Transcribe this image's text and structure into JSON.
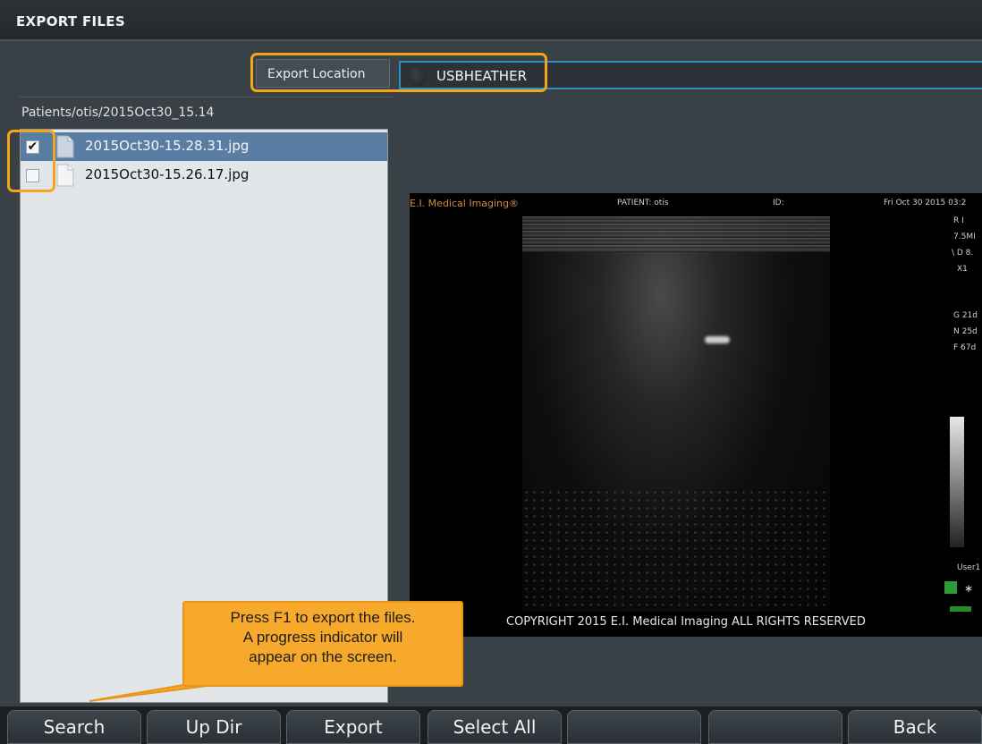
{
  "window": {
    "title": "EXPORT FILES"
  },
  "export_location": {
    "label": "Export Location",
    "value": "USBHEATHER",
    "icon": "usb-drive-icon"
  },
  "path": "Patients/otis/2015Oct30_15.14",
  "files": [
    {
      "name": "2015Oct30-15.28.31.jpg",
      "checked": true,
      "selected": true,
      "check_mark": "✔"
    },
    {
      "name": "2015Oct30-15.26.17.jpg",
      "checked": false,
      "selected": false,
      "check_mark": ""
    }
  ],
  "preview": {
    "brand": "E.I. Medical Imaging®",
    "patient": "PATIENT: otis",
    "id": "ID:",
    "date": "Fri Oct 30 2015 03:2",
    "side_labels": [
      "R   I",
      "7.5MI",
      "\\ D 8.",
      "X1",
      "G 21d",
      "N 25d",
      "F 67d",
      "User1"
    ],
    "copyright": "COPYRIGHT 2015 E.I. Medical Imaging ALL RIGHTS RESERVED"
  },
  "callout": {
    "lines": [
      "Press F1 to export the files.",
      "A progress indicator will",
      "appear on the screen."
    ]
  },
  "buttons": [
    "Search",
    "Up Dir",
    "Export",
    "Select All",
    "",
    "",
    "Back"
  ],
  "colors": {
    "highlight": "#f3a51b",
    "selection": "#5a7ea3",
    "callout": "#f7a92c",
    "field_border": "#2f8fc0"
  }
}
